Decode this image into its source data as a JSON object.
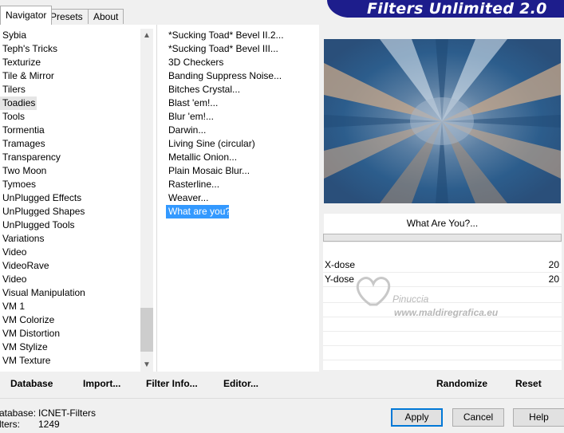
{
  "tabs": [
    {
      "label": "Navigator",
      "active": true
    },
    {
      "label": "Presets",
      "active": false
    },
    {
      "label": "About",
      "active": false
    }
  ],
  "banner_title": "Filters Unlimited 2.0",
  "categories": [
    "Sybia",
    "Teph's Tricks",
    "Texturize",
    "Tile & Mirror",
    "Tilers",
    "Toadies",
    "Tools",
    "Tormentia",
    "Tramages",
    "Transparency",
    "Two Moon",
    "Tymoes",
    "UnPlugged Effects",
    "UnPlugged Shapes",
    "UnPlugged Tools",
    "Variations",
    "Video",
    "VideoRave",
    "Video",
    "Visual Manipulation",
    "VM 1",
    "VM Colorize",
    "VM Distortion",
    "VM Stylize",
    "VM Texture"
  ],
  "selected_category": "Toadies",
  "filters": [
    "*Sucking Toad*  Bevel II.2...",
    "*Sucking Toad*  Bevel III...",
    "3D Checkers",
    "Banding Suppress Noise...",
    "Bitches Crystal...",
    "Blast 'em!...",
    "Blur 'em!...",
    "Darwin...",
    "Living Sine (circular)",
    "Metallic Onion...",
    "Plain Mosaic Blur...",
    "Rasterline...",
    "Weaver...",
    "What are you?"
  ],
  "selected_filter": "What are you?",
  "filter_title": "What Are You?...",
  "params": [
    {
      "label": "X-dose",
      "value": "20"
    },
    {
      "label": "Y-dose",
      "value": "20"
    }
  ],
  "watermark": {
    "line1": "Pinuccia",
    "line2": "www.maldiregrafica.eu"
  },
  "buttons": {
    "database": "Database",
    "import": "Import...",
    "filter_info": "Filter Info...",
    "editor": "Editor...",
    "randomize": "Randomize",
    "reset": "Reset",
    "apply": "Apply",
    "cancel": "Cancel",
    "help": "Help"
  },
  "status": {
    "database_label": "atabase:",
    "database_value": "ICNET-Filters",
    "filters_label": "lters:",
    "filters_value": "1249"
  },
  "colors": {
    "banner": "#1d1d8c",
    "selection": "#3399ff",
    "preview_blue": "#2c5d8c",
    "preview_tan": "#c9a88a"
  },
  "icons": {
    "scroll_up": "chevron-up-icon",
    "scroll_down": "chevron-down-icon"
  }
}
